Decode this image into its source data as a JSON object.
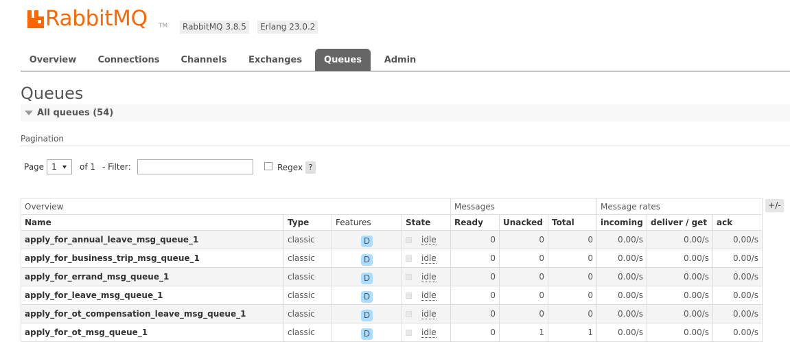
{
  "brand": {
    "logo_text": "RabbitMQ",
    "tm": "TM",
    "rabbitmq_version": "RabbitMQ 3.8.5",
    "erlang_version": "Erlang 23.0.2",
    "accent_color": "#ff6600"
  },
  "tabs": [
    {
      "label": "Overview",
      "active": false
    },
    {
      "label": "Connections",
      "active": false
    },
    {
      "label": "Channels",
      "active": false
    },
    {
      "label": "Exchanges",
      "active": false
    },
    {
      "label": "Queues",
      "active": true
    },
    {
      "label": "Admin",
      "active": false
    }
  ],
  "page": {
    "title": "Queues",
    "section_label": "All queues (54)"
  },
  "pagination": {
    "heading": "Pagination",
    "page_label": "Page",
    "page_value": "1",
    "of_label": "of 1",
    "filter_label": "- Filter:",
    "filter_value": "",
    "regex_label": "Regex",
    "regex_checked": false,
    "help_label": "?"
  },
  "table": {
    "group_headers": [
      "Overview",
      "Messages",
      "Message rates"
    ],
    "columns_toggle": "+/-",
    "columns": [
      "Name",
      "Type",
      "Features",
      "State",
      "Ready",
      "Unacked",
      "Total",
      "incoming",
      "deliver / get",
      "ack"
    ],
    "rows": [
      {
        "name": "apply_for_annual_leave_msg_queue_1",
        "type": "classic",
        "feature": "D",
        "state": "idle",
        "ready": "0",
        "unacked": "0",
        "total": "0",
        "incoming": "0.00/s",
        "deliver_get": "0.00/s",
        "ack": "0.00/s"
      },
      {
        "name": "apply_for_business_trip_msg_queue_1",
        "type": "classic",
        "feature": "D",
        "state": "idle",
        "ready": "0",
        "unacked": "0",
        "total": "0",
        "incoming": "0.00/s",
        "deliver_get": "0.00/s",
        "ack": "0.00/s"
      },
      {
        "name": "apply_for_errand_msg_queue_1",
        "type": "classic",
        "feature": "D",
        "state": "idle",
        "ready": "0",
        "unacked": "0",
        "total": "0",
        "incoming": "0.00/s",
        "deliver_get": "0.00/s",
        "ack": "0.00/s"
      },
      {
        "name": "apply_for_leave_msg_queue_1",
        "type": "classic",
        "feature": "D",
        "state": "idle",
        "ready": "0",
        "unacked": "0",
        "total": "0",
        "incoming": "0.00/s",
        "deliver_get": "0.00/s",
        "ack": "0.00/s"
      },
      {
        "name": "apply_for_ot_compensation_leave_msg_queue_1",
        "type": "classic",
        "feature": "D",
        "state": "idle",
        "ready": "0",
        "unacked": "0",
        "total": "0",
        "incoming": "0.00/s",
        "deliver_get": "0.00/s",
        "ack": "0.00/s"
      },
      {
        "name": "apply_for_ot_msg_queue_1",
        "type": "classic",
        "feature": "D",
        "state": "idle",
        "ready": "0",
        "unacked": "1",
        "total": "1",
        "incoming": "0.00/s",
        "deliver_get": "0.00/s",
        "ack": "0.00/s"
      }
    ]
  }
}
